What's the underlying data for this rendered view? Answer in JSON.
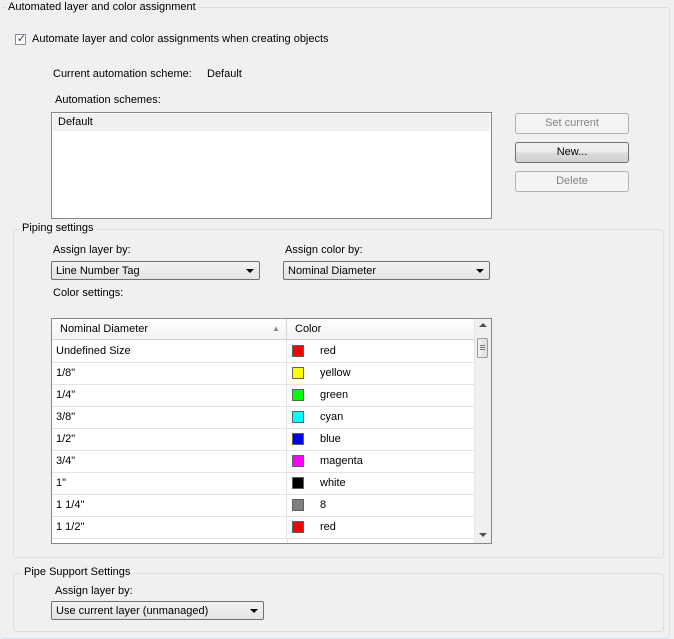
{
  "automated": {
    "group_title": "Automated layer and color assignment",
    "checkbox_label": "Automate layer and color assignments when creating objects",
    "checkbox_checked": true,
    "current_scheme_label": "Current automation scheme:",
    "current_scheme_value": "Default",
    "schemes_label": "Automation schemes:",
    "schemes": [
      "Default"
    ],
    "buttons": {
      "set_current": "Set current",
      "new": "New...",
      "delete": "Delete"
    }
  },
  "piping": {
    "group_title": "Piping settings",
    "assign_layer_label": "Assign layer by:",
    "assign_layer_value": "Line Number Tag",
    "assign_color_label": "Assign color by:",
    "assign_color_value": "Nominal Diameter",
    "color_settings_label": "Color settings:",
    "grid": {
      "col1": "Nominal Diameter",
      "col2": "Color",
      "rows": [
        {
          "size": "Undefined Size",
          "color_name": "red",
          "hex": "#ff0000"
        },
        {
          "size": "1/8\"",
          "color_name": "yellow",
          "hex": "#ffff00"
        },
        {
          "size": "1/4\"",
          "color_name": "green",
          "hex": "#00ff00"
        },
        {
          "size": "3/8\"",
          "color_name": "cyan",
          "hex": "#00ffff"
        },
        {
          "size": "1/2\"",
          "color_name": "blue",
          "hex": "#0000ff"
        },
        {
          "size": "3/4\"",
          "color_name": "magenta",
          "hex": "#ff00ff"
        },
        {
          "size": "1\"",
          "color_name": "white",
          "hex": "#000000"
        },
        {
          "size": "1 1/4\"",
          "color_name": "8",
          "hex": "#808080"
        },
        {
          "size": "1 1/2\"",
          "color_name": "red",
          "hex": "#ff0000"
        }
      ]
    }
  },
  "pipe_support": {
    "group_title": "Pipe Support Settings",
    "assign_layer_label": "Assign layer by:",
    "assign_layer_value": "Use current layer (unmanaged)"
  }
}
